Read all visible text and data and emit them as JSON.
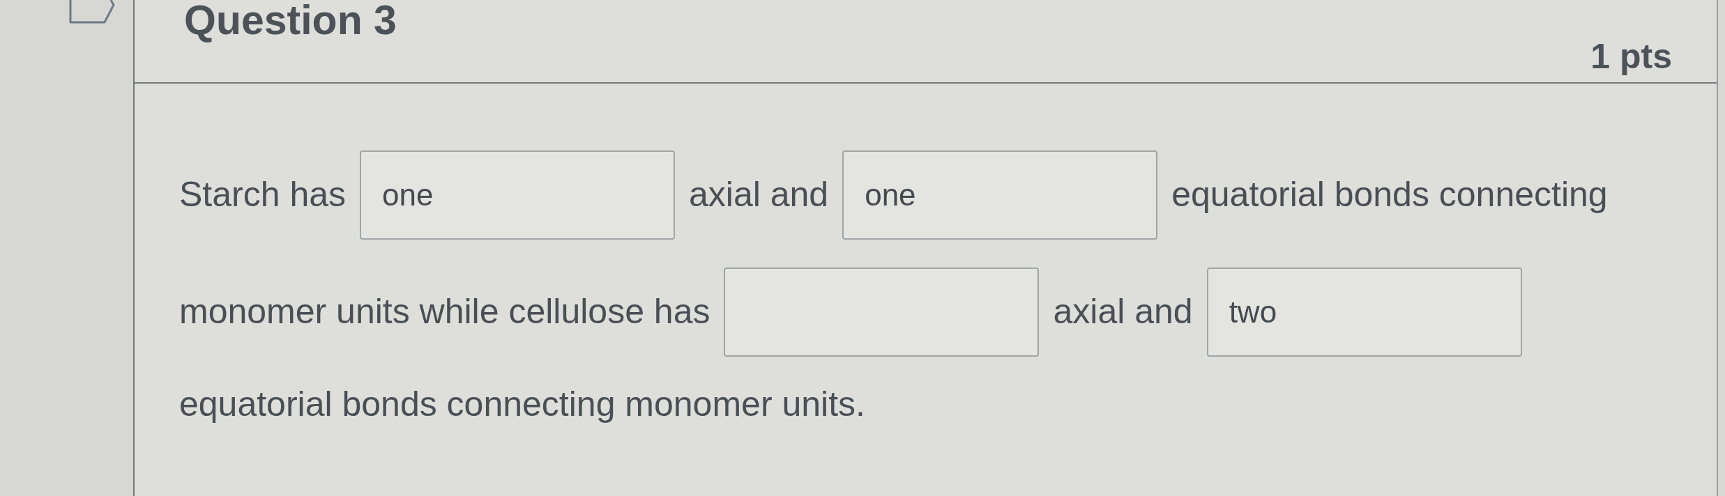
{
  "question": {
    "title": "Question 3",
    "points": "1 pts",
    "lines": [
      {
        "parts": [
          {
            "kind": "text",
            "text": "Starch has"
          },
          {
            "kind": "blank",
            "value": "one"
          },
          {
            "kind": "text",
            "text": "axial and"
          },
          {
            "kind": "blank",
            "value": "one"
          },
          {
            "kind": "text",
            "text": "equatorial bonds connecting"
          }
        ]
      },
      {
        "parts": [
          {
            "kind": "text",
            "text": "monomer units while cellulose has"
          },
          {
            "kind": "blank"
          },
          {
            "kind": "text",
            "text": "axial and"
          },
          {
            "kind": "blank",
            "value": "two"
          }
        ]
      },
      {
        "parts": [
          {
            "kind": "text",
            "text": "equatorial bonds connecting monomer units."
          }
        ]
      }
    ]
  }
}
